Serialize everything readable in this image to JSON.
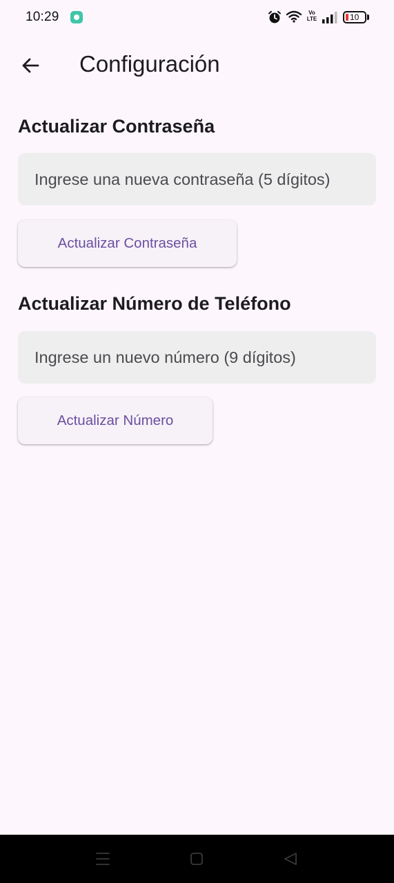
{
  "status_bar": {
    "time": "10:29",
    "volte_top": "Vo",
    "volte_bottom": "LTE",
    "battery_level": "10",
    "icons": [
      "app-notification-icon",
      "alarm-icon",
      "wifi-icon",
      "volte-icon",
      "signal-icon",
      "battery-icon"
    ]
  },
  "app_bar": {
    "title": "Configuración",
    "back_icon": "arrow-back-icon"
  },
  "password_section": {
    "title": "Actualizar Contraseña",
    "input_value": "",
    "input_placeholder": "Ingrese una nueva contraseña (5 dígitos)",
    "button_label": "Actualizar Contraseña"
  },
  "phone_section": {
    "title": "Actualizar Número de Teléfono",
    "input_value": "",
    "input_placeholder": "Ingrese un nuevo número (9 dígitos)",
    "button_label": "Actualizar Número"
  },
  "nav_bar": {
    "icons": [
      "menu-icon",
      "home-icon",
      "back-triangle-icon"
    ]
  },
  "colors": {
    "background": "#fdf7fd",
    "field_background": "#eeeeee",
    "button_background": "#f6f2f8",
    "button_text": "#6b4fa0",
    "nav_bar": "#000000",
    "battery_low": "#e53935"
  }
}
